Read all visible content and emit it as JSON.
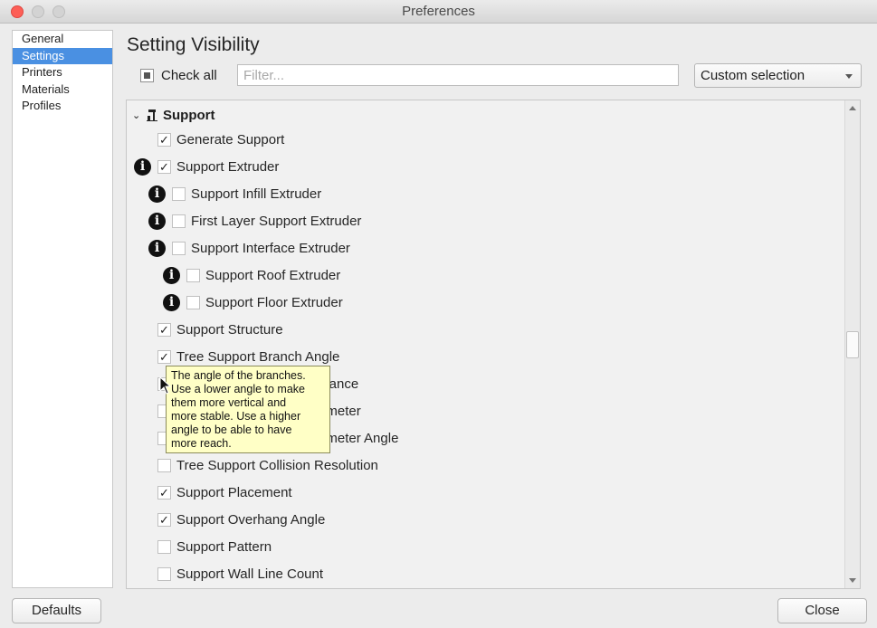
{
  "window": {
    "title": "Preferences"
  },
  "sidebar": {
    "items": [
      {
        "label": "General",
        "active": false
      },
      {
        "label": "Settings",
        "active": true
      },
      {
        "label": "Printers",
        "active": false
      },
      {
        "label": "Materials",
        "active": false
      },
      {
        "label": "Profiles",
        "active": false
      }
    ]
  },
  "main": {
    "title": "Setting Visibility",
    "check_all_label": "Check all",
    "filter": {
      "placeholder": "Filter...",
      "value": ""
    },
    "visibility_select": {
      "selected": "Custom selection"
    }
  },
  "settings_list": {
    "section": {
      "label": "Support",
      "icon": "support-category-icon",
      "expanded": true
    },
    "rows": [
      {
        "label": "Generate Support",
        "checked": true,
        "info": false,
        "indent": 0
      },
      {
        "label": "Support Extruder",
        "checked": true,
        "info": true,
        "indent": 0
      },
      {
        "label": "Support Infill Extruder",
        "checked": false,
        "info": true,
        "indent": 1
      },
      {
        "label": "First Layer Support Extruder",
        "checked": false,
        "info": true,
        "indent": 1
      },
      {
        "label": "Support Interface Extruder",
        "checked": false,
        "info": true,
        "indent": 1
      },
      {
        "label": "Support Roof Extruder",
        "checked": false,
        "info": true,
        "indent": 2
      },
      {
        "label": "Support Floor Extruder",
        "checked": false,
        "info": true,
        "indent": 2
      },
      {
        "label": "Support Structure",
        "checked": true,
        "info": false,
        "indent": 0
      },
      {
        "label": "Tree Support Branch Angle",
        "checked": true,
        "info": false,
        "indent": 0
      },
      {
        "label": "Tree Support Branch Distance",
        "checked": false,
        "info": false,
        "indent": 0
      },
      {
        "label": "Tree Support Branch Diameter",
        "checked": false,
        "info": false,
        "indent": 0
      },
      {
        "label": "Tree Support Branch Diameter Angle",
        "checked": false,
        "info": false,
        "indent": 0
      },
      {
        "label": "Tree Support Collision Resolution",
        "checked": false,
        "info": false,
        "indent": 0
      },
      {
        "label": "Support Placement",
        "checked": true,
        "info": false,
        "indent": 0
      },
      {
        "label": "Support Overhang Angle",
        "checked": true,
        "info": false,
        "indent": 0
      },
      {
        "label": "Support Pattern",
        "checked": false,
        "info": false,
        "indent": 0
      },
      {
        "label": "Support Wall Line Count",
        "checked": false,
        "info": false,
        "indent": 0
      }
    ]
  },
  "tooltip": {
    "lines": [
      "The angle of the branches.",
      "Use a lower angle to make",
      "them more vertical and",
      "more stable. Use a higher",
      "angle to be able to have",
      "more reach."
    ]
  },
  "footer": {
    "defaults_label": "Defaults",
    "close_label": "Close"
  },
  "glyphs": {
    "check": "✓",
    "info": "i",
    "chevron": "⌄"
  }
}
